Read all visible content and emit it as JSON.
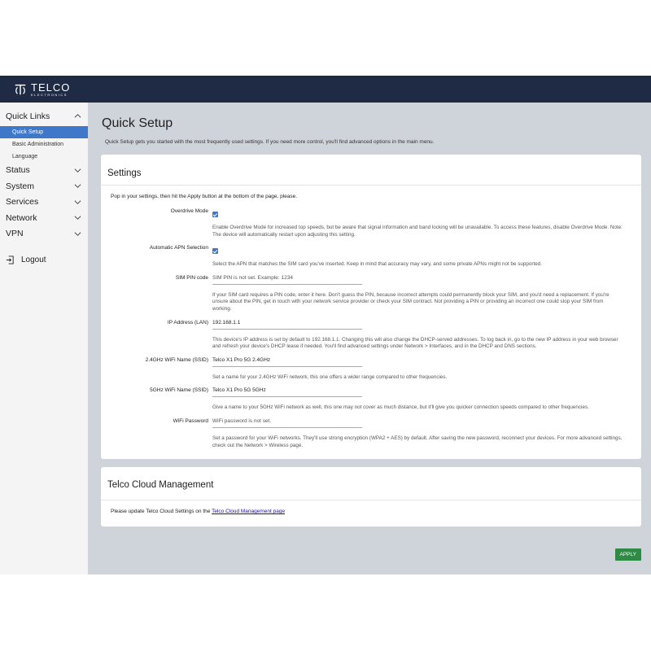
{
  "brand": {
    "name": "TELCO",
    "tagline": "ELECTRONICS"
  },
  "sidebar": {
    "groups": [
      {
        "label": "Quick Links",
        "expanded": true,
        "items": [
          "Quick Setup",
          "Basic Administration",
          "Language"
        ],
        "active": "Quick Setup"
      },
      {
        "label": "Status",
        "expanded": false
      },
      {
        "label": "System",
        "expanded": false
      },
      {
        "label": "Services",
        "expanded": false
      },
      {
        "label": "Network",
        "expanded": false
      },
      {
        "label": "VPN",
        "expanded": false
      }
    ],
    "logout": "Logout"
  },
  "page": {
    "title": "Quick Setup",
    "intro": "Quick Setup gets you started with the most frequently used settings. If you need more control, you'll find advanced options in the main menu."
  },
  "settings": {
    "title": "Settings",
    "lead": "Pop in your settings, then hit the Apply button at the bottom of the page, please.",
    "overdrive": {
      "label": "Overdrive Mode",
      "checked": true,
      "help": "Enable Overdrive Mode for increased top speeds, but be aware that signal information and band locking will be unavailable. To access these features, disable Overdrive Mode. Note: The device will automatically restart upon adjusting this setting."
    },
    "apn": {
      "label": "Automatic APN Selection",
      "checked": true,
      "help": "Select the APN that matches the SIM card you've inserted. Keep in mind that accuracy may vary, and some private APNs might not be supported."
    },
    "sim_pin": {
      "label": "SIM PIN code",
      "value": "SIM PIN is not set. Example: 1234",
      "help": "If your SIM card requires a PIN code, enter it here. Don't guess the PIN, because incorrect attempts could permanently block your SIM, and you'd need a replacement. If you're unsure about the PIN, get in touch with your network service provider or check your SIM contract. Not providing a PIN or providing an incorrect one could stop your SIM from working."
    },
    "ip": {
      "label": "IP Address (LAN)",
      "value": "192.168.1.1",
      "help": "This device's IP address is set by default to 192.168.1.1. Changing this will also change the DHCP-served addresses. To log back in, go to the new IP address in your web browser and refresh your device's DHCP lease if needed. You'll find advanced settings under Network > Interfaces, and in the DHCP and DNS sections."
    },
    "ssid24": {
      "label": "2.4GHz WiFi Name (SSID)",
      "value": "Telco X1 Pro 5G 2.4GHz",
      "help": "Set a name for your 2.4GHz WiFi network, this one offers a wider range compared to other frequencies."
    },
    "ssid5": {
      "label": "5GHz WiFi Name (SSID)",
      "value": "Telco X1 Pro 5G 5GHz",
      "help": "Give a name to your 5GHz WiFi network as well, this one may not cover as much distance, but it'll give you quicker connection speeds compared to other frequencies."
    },
    "wifi_pw": {
      "label": "WiFi Password",
      "value": "WiFi password is not set.",
      "help": "Set a password for your WiFi networks. They'll use strong encryption (WPA2 + AES) by default. After saving the new password, reconnect your devices. For more advanced settings, check out the Network > Wireless page."
    }
  },
  "cloud": {
    "title": "Telco Cloud Management",
    "text": "Please update Telco Cloud Settings on the",
    "link": "Telco Cloud Management page"
  },
  "apply_label": "APPLY",
  "colors": {
    "header": "#1f2a44",
    "accent": "#3f78c9",
    "apply": "#2f8a46",
    "main_bg": "#cfd3da"
  }
}
